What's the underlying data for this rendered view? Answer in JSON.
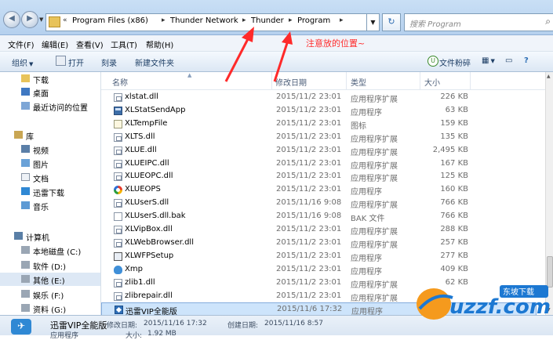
{
  "address": {
    "crumbs": [
      "Program Files (x86)",
      "Thunder Network",
      "Thunder",
      "Program"
    ],
    "prefix": "«"
  },
  "search": {
    "placeholder": "搜索 Program"
  },
  "menu": [
    "文件(F)",
    "编辑(E)",
    "查看(V)",
    "工具(T)",
    "帮助(H)"
  ],
  "annotation": "注意放的位置~",
  "toolbar": {
    "organize": "组织",
    "open": "打开",
    "burn": "刻录",
    "new_folder": "新建文件夹",
    "shred": "文件粉碎"
  },
  "nav": [
    {
      "label": "下载",
      "icon": "download-folder-icon"
    },
    {
      "label": "桌面",
      "icon": "desktop-icon"
    },
    {
      "label": "最近访问的位置",
      "icon": "recent-places-icon"
    },
    {
      "label": "库",
      "icon": "library-icon"
    },
    {
      "label": "视频",
      "icon": "videos-icon"
    },
    {
      "label": "图片",
      "icon": "pictures-icon"
    },
    {
      "label": "文档",
      "icon": "documents-icon"
    },
    {
      "label": "迅雷下载",
      "icon": "thunder-download-icon"
    },
    {
      "label": "音乐",
      "icon": "music-icon"
    },
    {
      "label": "计算机",
      "icon": "computer-icon"
    },
    {
      "label": "本地磁盘 (C:)",
      "icon": "drive-icon"
    },
    {
      "label": "软件 (D:)",
      "icon": "drive-icon"
    },
    {
      "label": "其他 (E:)",
      "icon": "drive-icon"
    },
    {
      "label": "娱乐 (F:)",
      "icon": "drive-icon"
    },
    {
      "label": "资料 (G:)",
      "icon": "drive-icon"
    }
  ],
  "columns": {
    "name": "名称",
    "modified": "修改日期",
    "type": "类型",
    "size": "大小"
  },
  "files": [
    {
      "name": "xlstat.dll",
      "modified": "2015/11/2 23:01",
      "type": "应用程序扩展",
      "size": "226 KB",
      "icon": "dll"
    },
    {
      "name": "XLStatSendApp",
      "modified": "2015/11/2 23:01",
      "type": "应用程序",
      "size": "63 KB",
      "icon": "app"
    },
    {
      "name": "XLTempFile",
      "modified": "2015/11/2 23:01",
      "type": "图标",
      "size": "159 KB",
      "icon": "img"
    },
    {
      "name": "XLTS.dll",
      "modified": "2015/11/2 23:01",
      "type": "应用程序扩展",
      "size": "135 KB",
      "icon": "dll"
    },
    {
      "name": "XLUE.dll",
      "modified": "2015/11/2 23:01",
      "type": "应用程序扩展",
      "size": "2,495 KB",
      "icon": "dll"
    },
    {
      "name": "XLUEIPC.dll",
      "modified": "2015/11/2 23:01",
      "type": "应用程序扩展",
      "size": "167 KB",
      "icon": "dll"
    },
    {
      "name": "XLUEOPC.dll",
      "modified": "2015/11/2 23:01",
      "type": "应用程序扩展",
      "size": "125 KB",
      "icon": "dll"
    },
    {
      "name": "XLUEOPS",
      "modified": "2015/11/2 23:01",
      "type": "应用程序",
      "size": "160 KB",
      "icon": "ops"
    },
    {
      "name": "XLUserS.dll",
      "modified": "2015/11/16 9:08",
      "type": "应用程序扩展",
      "size": "766 KB",
      "icon": "dll"
    },
    {
      "name": "XLUserS.dll.bak",
      "modified": "2015/11/16 9:08",
      "type": "BAK 文件",
      "size": "766 KB",
      "icon": "doc"
    },
    {
      "name": "XLVipBox.dll",
      "modified": "2015/11/2 23:01",
      "type": "应用程序扩展",
      "size": "288 KB",
      "icon": "dll"
    },
    {
      "name": "XLWebBrowser.dll",
      "modified": "2015/11/2 23:01",
      "type": "应用程序扩展",
      "size": "257 KB",
      "icon": "dll"
    },
    {
      "name": "XLWFPSetup",
      "modified": "2015/11/2 23:01",
      "type": "应用程序",
      "size": "277 KB",
      "icon": "app2"
    },
    {
      "name": "Xmp",
      "modified": "2015/11/2 23:01",
      "type": "应用程序",
      "size": "409 KB",
      "icon": "cloud"
    },
    {
      "name": "zlib1.dll",
      "modified": "2015/11/2 23:01",
      "type": "应用程序扩展",
      "size": "62 KB",
      "icon": "dll"
    },
    {
      "name": "zlibrepair.dll",
      "modified": "2015/11/2 23:01",
      "type": "应用程序扩展",
      "size": "",
      "icon": "dll"
    },
    {
      "name": "迅雷VIP全能版",
      "modified": "2015/11/6 17:32",
      "type": "应用程序",
      "size": "",
      "icon": "wlink"
    }
  ],
  "details": {
    "name": "迅雷VIP全能版",
    "modified_label": "修改日期:",
    "modified": "2015/11/16 17:32",
    "created_label": "创建日期:",
    "created": "2015/11/16 8:57",
    "type": "应用程序",
    "size_label": "大小:",
    "size": "1.92 MB"
  },
  "watermark": {
    "logo": "uzzf.com",
    "tagline": "东坡下载"
  }
}
